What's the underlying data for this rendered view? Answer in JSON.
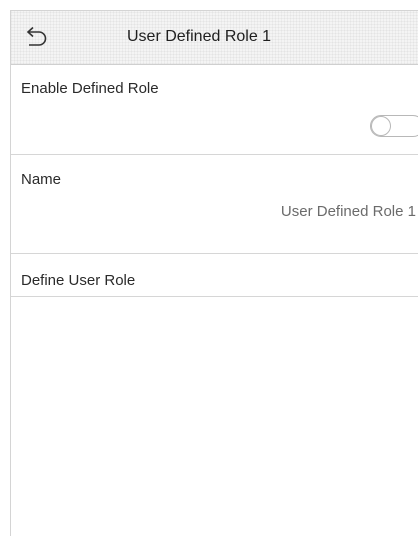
{
  "header": {
    "title": "User Defined Role 1",
    "back_icon": "back-arrow-icon"
  },
  "settings": {
    "enable_role": {
      "label": "Enable Defined Role",
      "enabled": false
    },
    "name": {
      "label": "Name",
      "value": "User Defined Role 1"
    },
    "define_role": {
      "label": "Define User Role"
    }
  }
}
